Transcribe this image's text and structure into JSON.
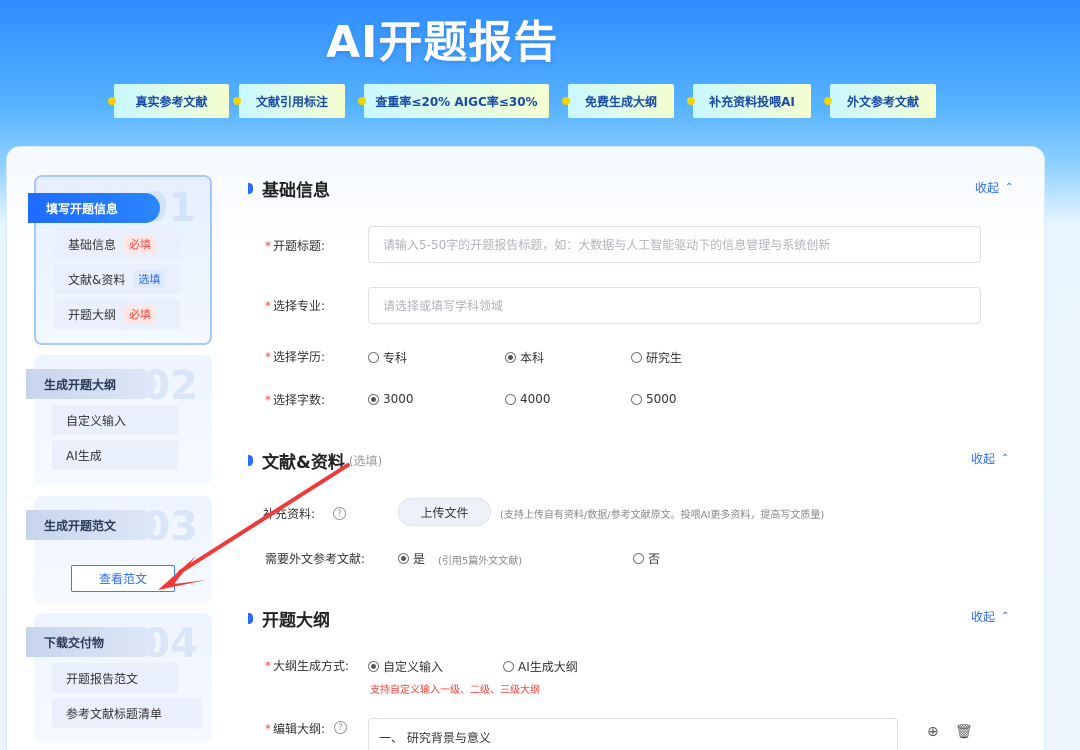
{
  "hero": {
    "title": "AI开题报告"
  },
  "features": [
    "真实参考文献",
    "文献引用标注",
    "查重率≤20%  AIGC率≤30%",
    "免费生成大纲",
    "补充资料投喂AI",
    "外文参考文献"
  ],
  "sidebar": {
    "steps": [
      {
        "num": "01",
        "label": "填写开题信息",
        "items": [
          {
            "label": "基础信息",
            "tag": "必填"
          },
          {
            "label": "文献&资料",
            "tag": "选填"
          },
          {
            "label": "开题大纲",
            "tag": "必填"
          }
        ]
      },
      {
        "num": "02",
        "label": "生成开题大纲",
        "items": [
          {
            "label": "自定义输入"
          },
          {
            "label": "AI生成"
          }
        ]
      },
      {
        "num": "03",
        "label": "生成开题范文",
        "button": "查看范文"
      },
      {
        "num": "04",
        "label": "下载交付物",
        "items": [
          {
            "label": "开题报告范文"
          },
          {
            "label": "参考文献标题清单"
          }
        ]
      }
    ]
  },
  "basic": {
    "title": "基础信息",
    "collapse": "收起",
    "title_field": {
      "label": "开题标题:",
      "placeholder": "请输入5-50字的开题报告标题，如：大数据与人工智能驱动下的信息管理与系统创新"
    },
    "major_field": {
      "label": "选择专业:",
      "placeholder": "请选择或填写学科领域"
    },
    "education": {
      "label": "选择学历:",
      "options": [
        "专科",
        "本科",
        "研究生"
      ],
      "selected": "本科"
    },
    "word_count": {
      "label": "选择字数:",
      "options": [
        "3000",
        "4000",
        "5000"
      ],
      "selected": "3000"
    }
  },
  "literature": {
    "title": "文献&资料",
    "subtitle": "(选填)",
    "collapse": "收起",
    "supplement_label": "补充资料:",
    "help": "?",
    "upload": "上传文件",
    "upload_hint": "(支持上传自有资料/数据/参考文献原文。投喂AI更多资料，提高写文质量)",
    "foreign_label": "需要外文参考文献:",
    "yes": "是",
    "yes_hint": "(引用5篇外文文献)",
    "no": "否"
  },
  "outline": {
    "title": "开题大纲",
    "collapse": "收起",
    "method_label": "大纲生成方式:",
    "method_options": [
      "自定义输入",
      "AI生成大纲"
    ],
    "method_selected": "自定义输入",
    "method_hint": "支持自定义输入一级、二级、三级大纲",
    "edit_label": "编辑大纲:",
    "edit_help": "?",
    "first_item": "一、  研究背景与意义"
  },
  "colors": {
    "accent": "#2a6cff",
    "required": "#f0443b",
    "annotation_arrow": "#f03a3a"
  },
  "icons": {
    "add": "plus-circle-icon",
    "delete": "trash-icon",
    "collapse": "chevron-up-icon"
  }
}
